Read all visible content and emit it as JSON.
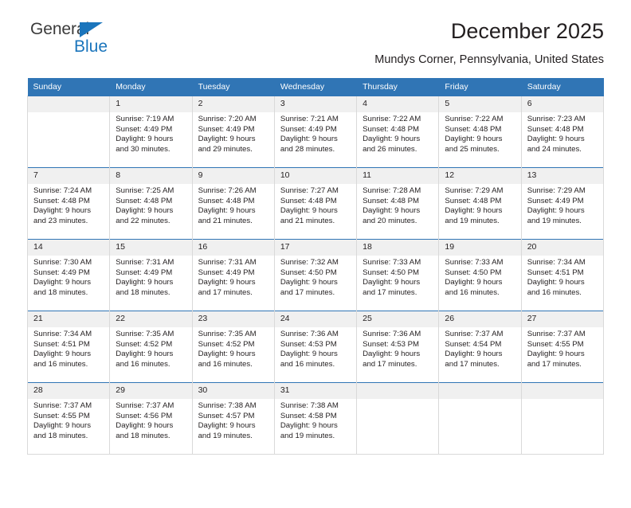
{
  "brand": {
    "name_part1": "General",
    "name_part2": "Blue",
    "triangle_color": "#1b75bc"
  },
  "header": {
    "title": "December 2025",
    "location": "Mundys Corner, Pennsylvania, United States"
  },
  "colors": {
    "header_blue": "#3075b5",
    "daynum_band": "#f0f0f0",
    "grid_line": "#d9d9d9",
    "text": "#231f20"
  },
  "weekday_headers": [
    "Sunday",
    "Monday",
    "Tuesday",
    "Wednesday",
    "Thursday",
    "Friday",
    "Saturday"
  ],
  "labels": {
    "sunrise_prefix": "Sunrise:",
    "sunset_prefix": "Sunset:",
    "daylight_prefix": "Daylight:"
  },
  "weeks": [
    [
      {
        "day": "",
        "sunrise": "",
        "sunset": "",
        "daylight_line1": "",
        "daylight_line2": ""
      },
      {
        "day": "1",
        "sunrise": "Sunrise: 7:19 AM",
        "sunset": "Sunset: 4:49 PM",
        "daylight_line1": "Daylight: 9 hours",
        "daylight_line2": "and 30 minutes."
      },
      {
        "day": "2",
        "sunrise": "Sunrise: 7:20 AM",
        "sunset": "Sunset: 4:49 PM",
        "daylight_line1": "Daylight: 9 hours",
        "daylight_line2": "and 29 minutes."
      },
      {
        "day": "3",
        "sunrise": "Sunrise: 7:21 AM",
        "sunset": "Sunset: 4:49 PM",
        "daylight_line1": "Daylight: 9 hours",
        "daylight_line2": "and 28 minutes."
      },
      {
        "day": "4",
        "sunrise": "Sunrise: 7:22 AM",
        "sunset": "Sunset: 4:48 PM",
        "daylight_line1": "Daylight: 9 hours",
        "daylight_line2": "and 26 minutes."
      },
      {
        "day": "5",
        "sunrise": "Sunrise: 7:22 AM",
        "sunset": "Sunset: 4:48 PM",
        "daylight_line1": "Daylight: 9 hours",
        "daylight_line2": "and 25 minutes."
      },
      {
        "day": "6",
        "sunrise": "Sunrise: 7:23 AM",
        "sunset": "Sunset: 4:48 PM",
        "daylight_line1": "Daylight: 9 hours",
        "daylight_line2": "and 24 minutes."
      }
    ],
    [
      {
        "day": "7",
        "sunrise": "Sunrise: 7:24 AM",
        "sunset": "Sunset: 4:48 PM",
        "daylight_line1": "Daylight: 9 hours",
        "daylight_line2": "and 23 minutes."
      },
      {
        "day": "8",
        "sunrise": "Sunrise: 7:25 AM",
        "sunset": "Sunset: 4:48 PM",
        "daylight_line1": "Daylight: 9 hours",
        "daylight_line2": "and 22 minutes."
      },
      {
        "day": "9",
        "sunrise": "Sunrise: 7:26 AM",
        "sunset": "Sunset: 4:48 PM",
        "daylight_line1": "Daylight: 9 hours",
        "daylight_line2": "and 21 minutes."
      },
      {
        "day": "10",
        "sunrise": "Sunrise: 7:27 AM",
        "sunset": "Sunset: 4:48 PM",
        "daylight_line1": "Daylight: 9 hours",
        "daylight_line2": "and 21 minutes."
      },
      {
        "day": "11",
        "sunrise": "Sunrise: 7:28 AM",
        "sunset": "Sunset: 4:48 PM",
        "daylight_line1": "Daylight: 9 hours",
        "daylight_line2": "and 20 minutes."
      },
      {
        "day": "12",
        "sunrise": "Sunrise: 7:29 AM",
        "sunset": "Sunset: 4:48 PM",
        "daylight_line1": "Daylight: 9 hours",
        "daylight_line2": "and 19 minutes."
      },
      {
        "day": "13",
        "sunrise": "Sunrise: 7:29 AM",
        "sunset": "Sunset: 4:49 PM",
        "daylight_line1": "Daylight: 9 hours",
        "daylight_line2": "and 19 minutes."
      }
    ],
    [
      {
        "day": "14",
        "sunrise": "Sunrise: 7:30 AM",
        "sunset": "Sunset: 4:49 PM",
        "daylight_line1": "Daylight: 9 hours",
        "daylight_line2": "and 18 minutes."
      },
      {
        "day": "15",
        "sunrise": "Sunrise: 7:31 AM",
        "sunset": "Sunset: 4:49 PM",
        "daylight_line1": "Daylight: 9 hours",
        "daylight_line2": "and 18 minutes."
      },
      {
        "day": "16",
        "sunrise": "Sunrise: 7:31 AM",
        "sunset": "Sunset: 4:49 PM",
        "daylight_line1": "Daylight: 9 hours",
        "daylight_line2": "and 17 minutes."
      },
      {
        "day": "17",
        "sunrise": "Sunrise: 7:32 AM",
        "sunset": "Sunset: 4:50 PM",
        "daylight_line1": "Daylight: 9 hours",
        "daylight_line2": "and 17 minutes."
      },
      {
        "day": "18",
        "sunrise": "Sunrise: 7:33 AM",
        "sunset": "Sunset: 4:50 PM",
        "daylight_line1": "Daylight: 9 hours",
        "daylight_line2": "and 17 minutes."
      },
      {
        "day": "19",
        "sunrise": "Sunrise: 7:33 AM",
        "sunset": "Sunset: 4:50 PM",
        "daylight_line1": "Daylight: 9 hours",
        "daylight_line2": "and 16 minutes."
      },
      {
        "day": "20",
        "sunrise": "Sunrise: 7:34 AM",
        "sunset": "Sunset: 4:51 PM",
        "daylight_line1": "Daylight: 9 hours",
        "daylight_line2": "and 16 minutes."
      }
    ],
    [
      {
        "day": "21",
        "sunrise": "Sunrise: 7:34 AM",
        "sunset": "Sunset: 4:51 PM",
        "daylight_line1": "Daylight: 9 hours",
        "daylight_line2": "and 16 minutes."
      },
      {
        "day": "22",
        "sunrise": "Sunrise: 7:35 AM",
        "sunset": "Sunset: 4:52 PM",
        "daylight_line1": "Daylight: 9 hours",
        "daylight_line2": "and 16 minutes."
      },
      {
        "day": "23",
        "sunrise": "Sunrise: 7:35 AM",
        "sunset": "Sunset: 4:52 PM",
        "daylight_line1": "Daylight: 9 hours",
        "daylight_line2": "and 16 minutes."
      },
      {
        "day": "24",
        "sunrise": "Sunrise: 7:36 AM",
        "sunset": "Sunset: 4:53 PM",
        "daylight_line1": "Daylight: 9 hours",
        "daylight_line2": "and 16 minutes."
      },
      {
        "day": "25",
        "sunrise": "Sunrise: 7:36 AM",
        "sunset": "Sunset: 4:53 PM",
        "daylight_line1": "Daylight: 9 hours",
        "daylight_line2": "and 17 minutes."
      },
      {
        "day": "26",
        "sunrise": "Sunrise: 7:37 AM",
        "sunset": "Sunset: 4:54 PM",
        "daylight_line1": "Daylight: 9 hours",
        "daylight_line2": "and 17 minutes."
      },
      {
        "day": "27",
        "sunrise": "Sunrise: 7:37 AM",
        "sunset": "Sunset: 4:55 PM",
        "daylight_line1": "Daylight: 9 hours",
        "daylight_line2": "and 17 minutes."
      }
    ],
    [
      {
        "day": "28",
        "sunrise": "Sunrise: 7:37 AM",
        "sunset": "Sunset: 4:55 PM",
        "daylight_line1": "Daylight: 9 hours",
        "daylight_line2": "and 18 minutes."
      },
      {
        "day": "29",
        "sunrise": "Sunrise: 7:37 AM",
        "sunset": "Sunset: 4:56 PM",
        "daylight_line1": "Daylight: 9 hours",
        "daylight_line2": "and 18 minutes."
      },
      {
        "day": "30",
        "sunrise": "Sunrise: 7:38 AM",
        "sunset": "Sunset: 4:57 PM",
        "daylight_line1": "Daylight: 9 hours",
        "daylight_line2": "and 19 minutes."
      },
      {
        "day": "31",
        "sunrise": "Sunrise: 7:38 AM",
        "sunset": "Sunset: 4:58 PM",
        "daylight_line1": "Daylight: 9 hours",
        "daylight_line2": "and 19 minutes."
      },
      {
        "day": "",
        "sunrise": "",
        "sunset": "",
        "daylight_line1": "",
        "daylight_line2": ""
      },
      {
        "day": "",
        "sunrise": "",
        "sunset": "",
        "daylight_line1": "",
        "daylight_line2": ""
      },
      {
        "day": "",
        "sunrise": "",
        "sunset": "",
        "daylight_line1": "",
        "daylight_line2": ""
      }
    ]
  ]
}
